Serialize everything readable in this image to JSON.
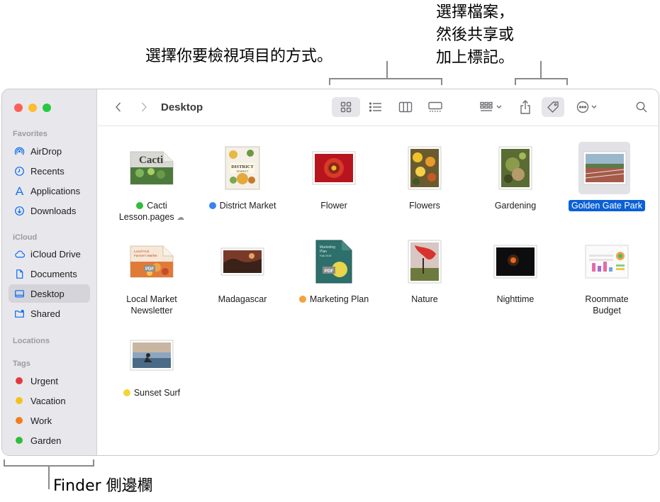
{
  "callouts": {
    "view": "選擇你要檢視項目的方式。",
    "share_line1": "選擇檔案，",
    "share_line2": "然後共享或",
    "share_line3": "加上標記。",
    "sidebar": "Finder 側邊欄"
  },
  "window": {
    "title": "Desktop"
  },
  "sidebar": {
    "favorites_heading": "Favorites",
    "favorites": [
      {
        "label": "AirDrop",
        "icon": "airdrop-icon"
      },
      {
        "label": "Recents",
        "icon": "clock-icon"
      },
      {
        "label": "Applications",
        "icon": "applications-icon"
      },
      {
        "label": "Downloads",
        "icon": "download-icon"
      }
    ],
    "icloud_heading": "iCloud",
    "icloud": [
      {
        "label": "iCloud Drive",
        "icon": "cloud-icon"
      },
      {
        "label": "Documents",
        "icon": "document-icon"
      },
      {
        "label": "Desktop",
        "icon": "desktop-icon",
        "active": true
      },
      {
        "label": "Shared",
        "icon": "shared-folder-icon"
      }
    ],
    "locations_heading": "Locations",
    "tags_heading": "Tags",
    "tags": [
      {
        "label": "Urgent",
        "color": "#e8373a"
      },
      {
        "label": "Vacation",
        "color": "#f5c01d"
      },
      {
        "label": "Work",
        "color": "#f27e1b"
      },
      {
        "label": "Garden",
        "color": "#2fbd3b"
      }
    ]
  },
  "files": [
    {
      "name_line1": "Cacti",
      "name_line2": "Lesson.pages",
      "tag_color": "#2fbd3b",
      "cloud": true,
      "thumb": "cacti"
    },
    {
      "name_line1": "District Market",
      "name_line2": "",
      "tag_color": "#3b82f0",
      "thumb": "district"
    },
    {
      "name_line1": "Flower",
      "name_line2": "",
      "thumb": "flower"
    },
    {
      "name_line1": "Flowers",
      "name_line2": "",
      "thumb": "flowers"
    },
    {
      "name_line1": "Gardening",
      "name_line2": "",
      "thumb": "gardening"
    },
    {
      "name_line1": "Golden Gate Park",
      "name_line2": "",
      "selected": true,
      "thumb": "park"
    },
    {
      "name_line1": "Local Market",
      "name_line2": "Newsletter",
      "thumb": "local"
    },
    {
      "name_line1": "Madagascar",
      "name_line2": "",
      "thumb": "madagascar"
    },
    {
      "name_line1": "Marketing Plan",
      "name_line2": "",
      "tag_color": "#f2a33a",
      "thumb": "marketing"
    },
    {
      "name_line1": "Nature",
      "name_line2": "",
      "thumb": "nature"
    },
    {
      "name_line1": "Nighttime",
      "name_line2": "",
      "thumb": "night"
    },
    {
      "name_line1": "Roommate",
      "name_line2": "Budget",
      "thumb": "budget"
    },
    {
      "name_line1": "Sunset Surf",
      "name_line2": "",
      "tag_color": "#f5d33a",
      "thumb": "surf"
    }
  ],
  "thumb_text": {
    "cacti": "Cacti",
    "district_line1": "DISTRICT",
    "district_line2": "MARKET",
    "local_line1": "Local Fruit",
    "local_line2": "Farmer's Market",
    "marketing_line1": "Marketing",
    "marketing_line2": "Plan",
    "marketing_line3": "Fall 2019",
    "pdf": "PDF"
  }
}
